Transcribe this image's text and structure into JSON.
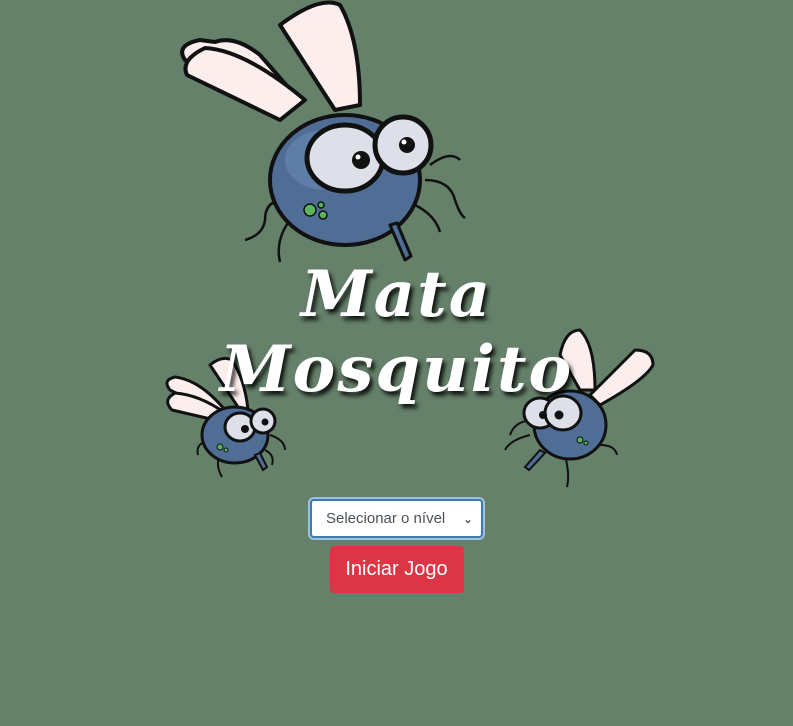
{
  "page": {
    "background_color": "#65816a"
  },
  "title": {
    "line1": "Mata",
    "line2": "Mosquito"
  },
  "level_select": {
    "selected_label": "Selecionar o nível",
    "icon": "chevron-down-icon"
  },
  "start_button": {
    "label": "Iniciar Jogo",
    "color": "#dc3545"
  },
  "decorations": {
    "mosquito_color": "#4f6d95",
    "wing_color": "#fdeeee"
  }
}
